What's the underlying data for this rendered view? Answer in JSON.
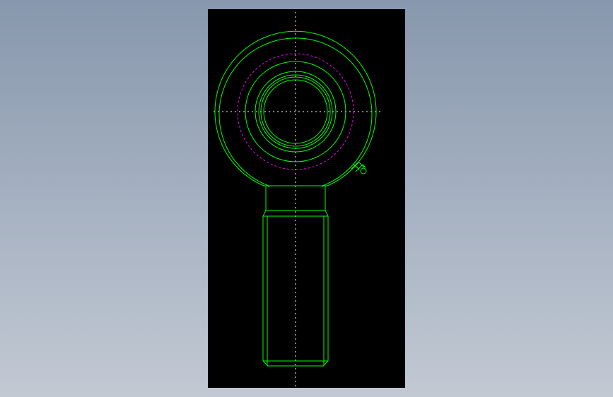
{
  "viewport": {
    "background": "#000000"
  },
  "colors": {
    "outline": "#00ff00",
    "hidden_line": "#ff00ff",
    "centerline": "#ffffff",
    "page_gradient_top": "#8797ad",
    "page_gradient_bottom": "#c2c9d3"
  },
  "drawing": {
    "subject": "rod-end-bearing-front-view",
    "visible_text": []
  }
}
